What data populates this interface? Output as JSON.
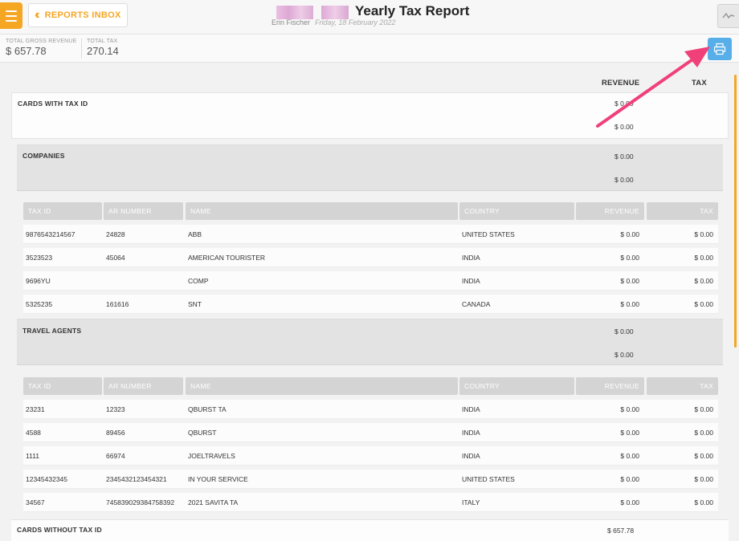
{
  "header": {
    "reports_inbox_label": "REPORTS INBOX",
    "title": "Yearly Tax Report",
    "user": "Erin Fischer",
    "date": "Friday, 18 February 2022",
    "icons": {
      "menu": "hamburger-icon",
      "back": "double-chevron-left-icon",
      "graph": "line-chart-icon",
      "print": "print-icon"
    }
  },
  "totals": {
    "gross_revenue_label": "TOTAL GROSS REVENUE",
    "gross_revenue_value": "$ 657.78",
    "tax_label": "TOTAL TAX",
    "tax_value": "270.14"
  },
  "columns": {
    "revenue": "REVENUE",
    "tax": "TAX"
  },
  "cards_with_tax_id": {
    "label": "CARDS WITH TAX ID",
    "revenue_1": "$ 0.00",
    "revenue_2": "$ 0.00"
  },
  "table_headers": [
    "TAX ID",
    "AR NUMBER",
    "NAME",
    "COUNTRY",
    "REVENUE",
    "TAX"
  ],
  "companies": {
    "label": "COMPANIES",
    "revenue_1": "$ 0.00",
    "revenue_2": "$ 0.00",
    "rows": [
      [
        "9876543214567",
        "24828",
        "ABB",
        "UNITED STATES",
        "$ 0.00",
        "$ 0.00"
      ],
      [
        "3523523",
        "45064",
        "AMERICAN TOURISTER",
        "INDIA",
        "$ 0.00",
        "$ 0.00"
      ],
      [
        "9696YU",
        "",
        "COMP",
        "INDIA",
        "$ 0.00",
        "$ 0.00"
      ],
      [
        "5325235",
        "161616",
        "SNT",
        "CANADA",
        "$ 0.00",
        "$ 0.00"
      ]
    ]
  },
  "travel_agents": {
    "label": "TRAVEL AGENTS",
    "revenue_1": "$ 0.00",
    "revenue_2": "$ 0.00",
    "rows": [
      [
        "23231",
        "12323",
        "QBURST TA",
        "INDIA",
        "$ 0.00",
        "$ 0.00"
      ],
      [
        "4588",
        "89456",
        "QBURST",
        "INDIA",
        "$ 0.00",
        "$ 0.00"
      ],
      [
        "1111",
        "66974",
        "JOELTRAVELS",
        "INDIA",
        "$ 0.00",
        "$ 0.00"
      ],
      [
        "12345432345",
        "2345432123454321",
        "IN YOUR SERVICE",
        "UNITED STATES",
        "$ 0.00",
        "$ 0.00"
      ],
      [
        "34567",
        "745839029384758392",
        "2021 SAVITA TA",
        "ITALY",
        "$ 0.00",
        "$ 0.00"
      ]
    ]
  },
  "cards_without_tax_id": {
    "label": "CARDS WITHOUT TAX ID",
    "revenue": "$ 657.78"
  },
  "colors": {
    "accent": "#f5a623",
    "print_button": "#58aee8",
    "annotation_arrow": "#f0407a"
  }
}
